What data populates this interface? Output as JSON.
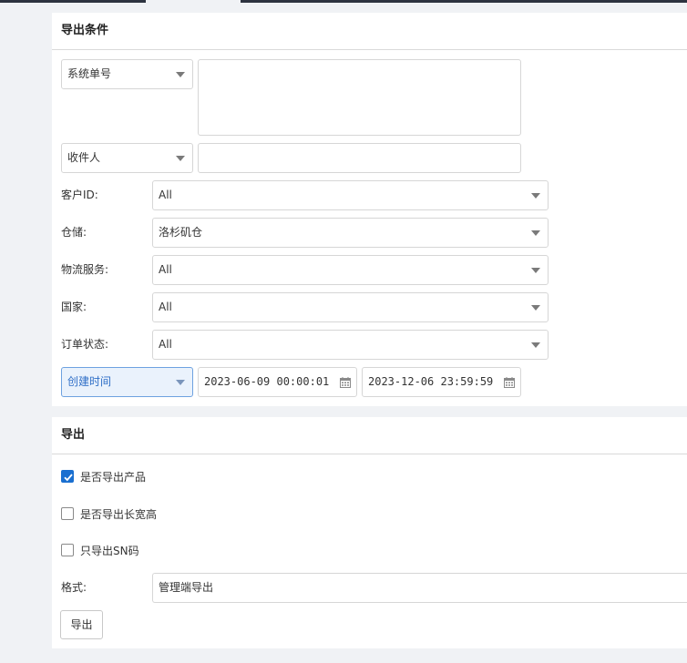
{
  "filters": {
    "title": "导出条件",
    "order_no_type": {
      "value": "系统单号",
      "textarea_value": ""
    },
    "recipient_type": {
      "value": "收件人",
      "input_value": ""
    },
    "customer_id": {
      "label": "客户ID:",
      "value": "All"
    },
    "warehouse": {
      "label": "仓储:",
      "value": "洛杉矶仓"
    },
    "logistics_service": {
      "label": "物流服务:",
      "value": "All"
    },
    "country": {
      "label": "国家:",
      "value": "All"
    },
    "order_status": {
      "label": "订单状态:",
      "value": "All"
    },
    "time_type": {
      "value": "创建时间"
    },
    "start_time": "2023-06-09 00:00:01",
    "end_time": "2023-12-06 23:59:59"
  },
  "export": {
    "title": "导出",
    "options": [
      {
        "label": "是否导出产品",
        "checked": true
      },
      {
        "label": "是否导出长宽高",
        "checked": false
      },
      {
        "label": "只导出SN码",
        "checked": false
      }
    ],
    "format": {
      "label": "格式:",
      "value": "管理端导出"
    },
    "export_button": "导出"
  },
  "colors": {
    "accent": "#1a6fd0",
    "active_select_bg": "#eaf2fc",
    "panel_bg": "#ffffff",
    "page_bg": "#f0f2f5"
  },
  "icons": {
    "dropdown": "chevron-down-icon",
    "date": "calendar-icon",
    "check": "check-icon"
  }
}
